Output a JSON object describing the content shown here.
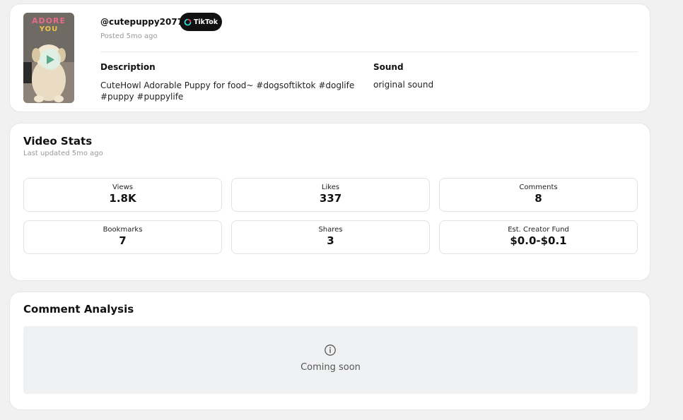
{
  "video": {
    "thumbnail_text_line1": "ADORE",
    "thumbnail_text_line2": "YOU",
    "handle": "@cutepuppy2077",
    "platform_badge": "TikTok",
    "posted": "Posted 5mo ago",
    "description_label": "Description",
    "description": "CuteHowl Adorable Puppy for food~ #dogsoftiktok #doglife #puppy #puppylife",
    "sound_label": "Sound",
    "sound": "original sound"
  },
  "stats": {
    "title": "Video Stats",
    "updated": "Last updated 5mo ago",
    "items": [
      {
        "label": "Views",
        "value": "1.8K"
      },
      {
        "label": "Likes",
        "value": "337"
      },
      {
        "label": "Comments",
        "value": "8"
      },
      {
        "label": "Bookmarks",
        "value": "7"
      },
      {
        "label": "Shares",
        "value": "3"
      },
      {
        "label": "Est. Creator Fund",
        "value": "$0.0-$0.1"
      }
    ]
  },
  "comment_analysis": {
    "title": "Comment Analysis",
    "status": "Coming soon",
    "icon": "info-icon"
  },
  "colors": {
    "card_bg": "#ffffff",
    "page_bg": "#f1f1f1",
    "badge_bg": "#111111",
    "muted_text": "#999999",
    "placeholder_bg": "#f0f1f3"
  }
}
